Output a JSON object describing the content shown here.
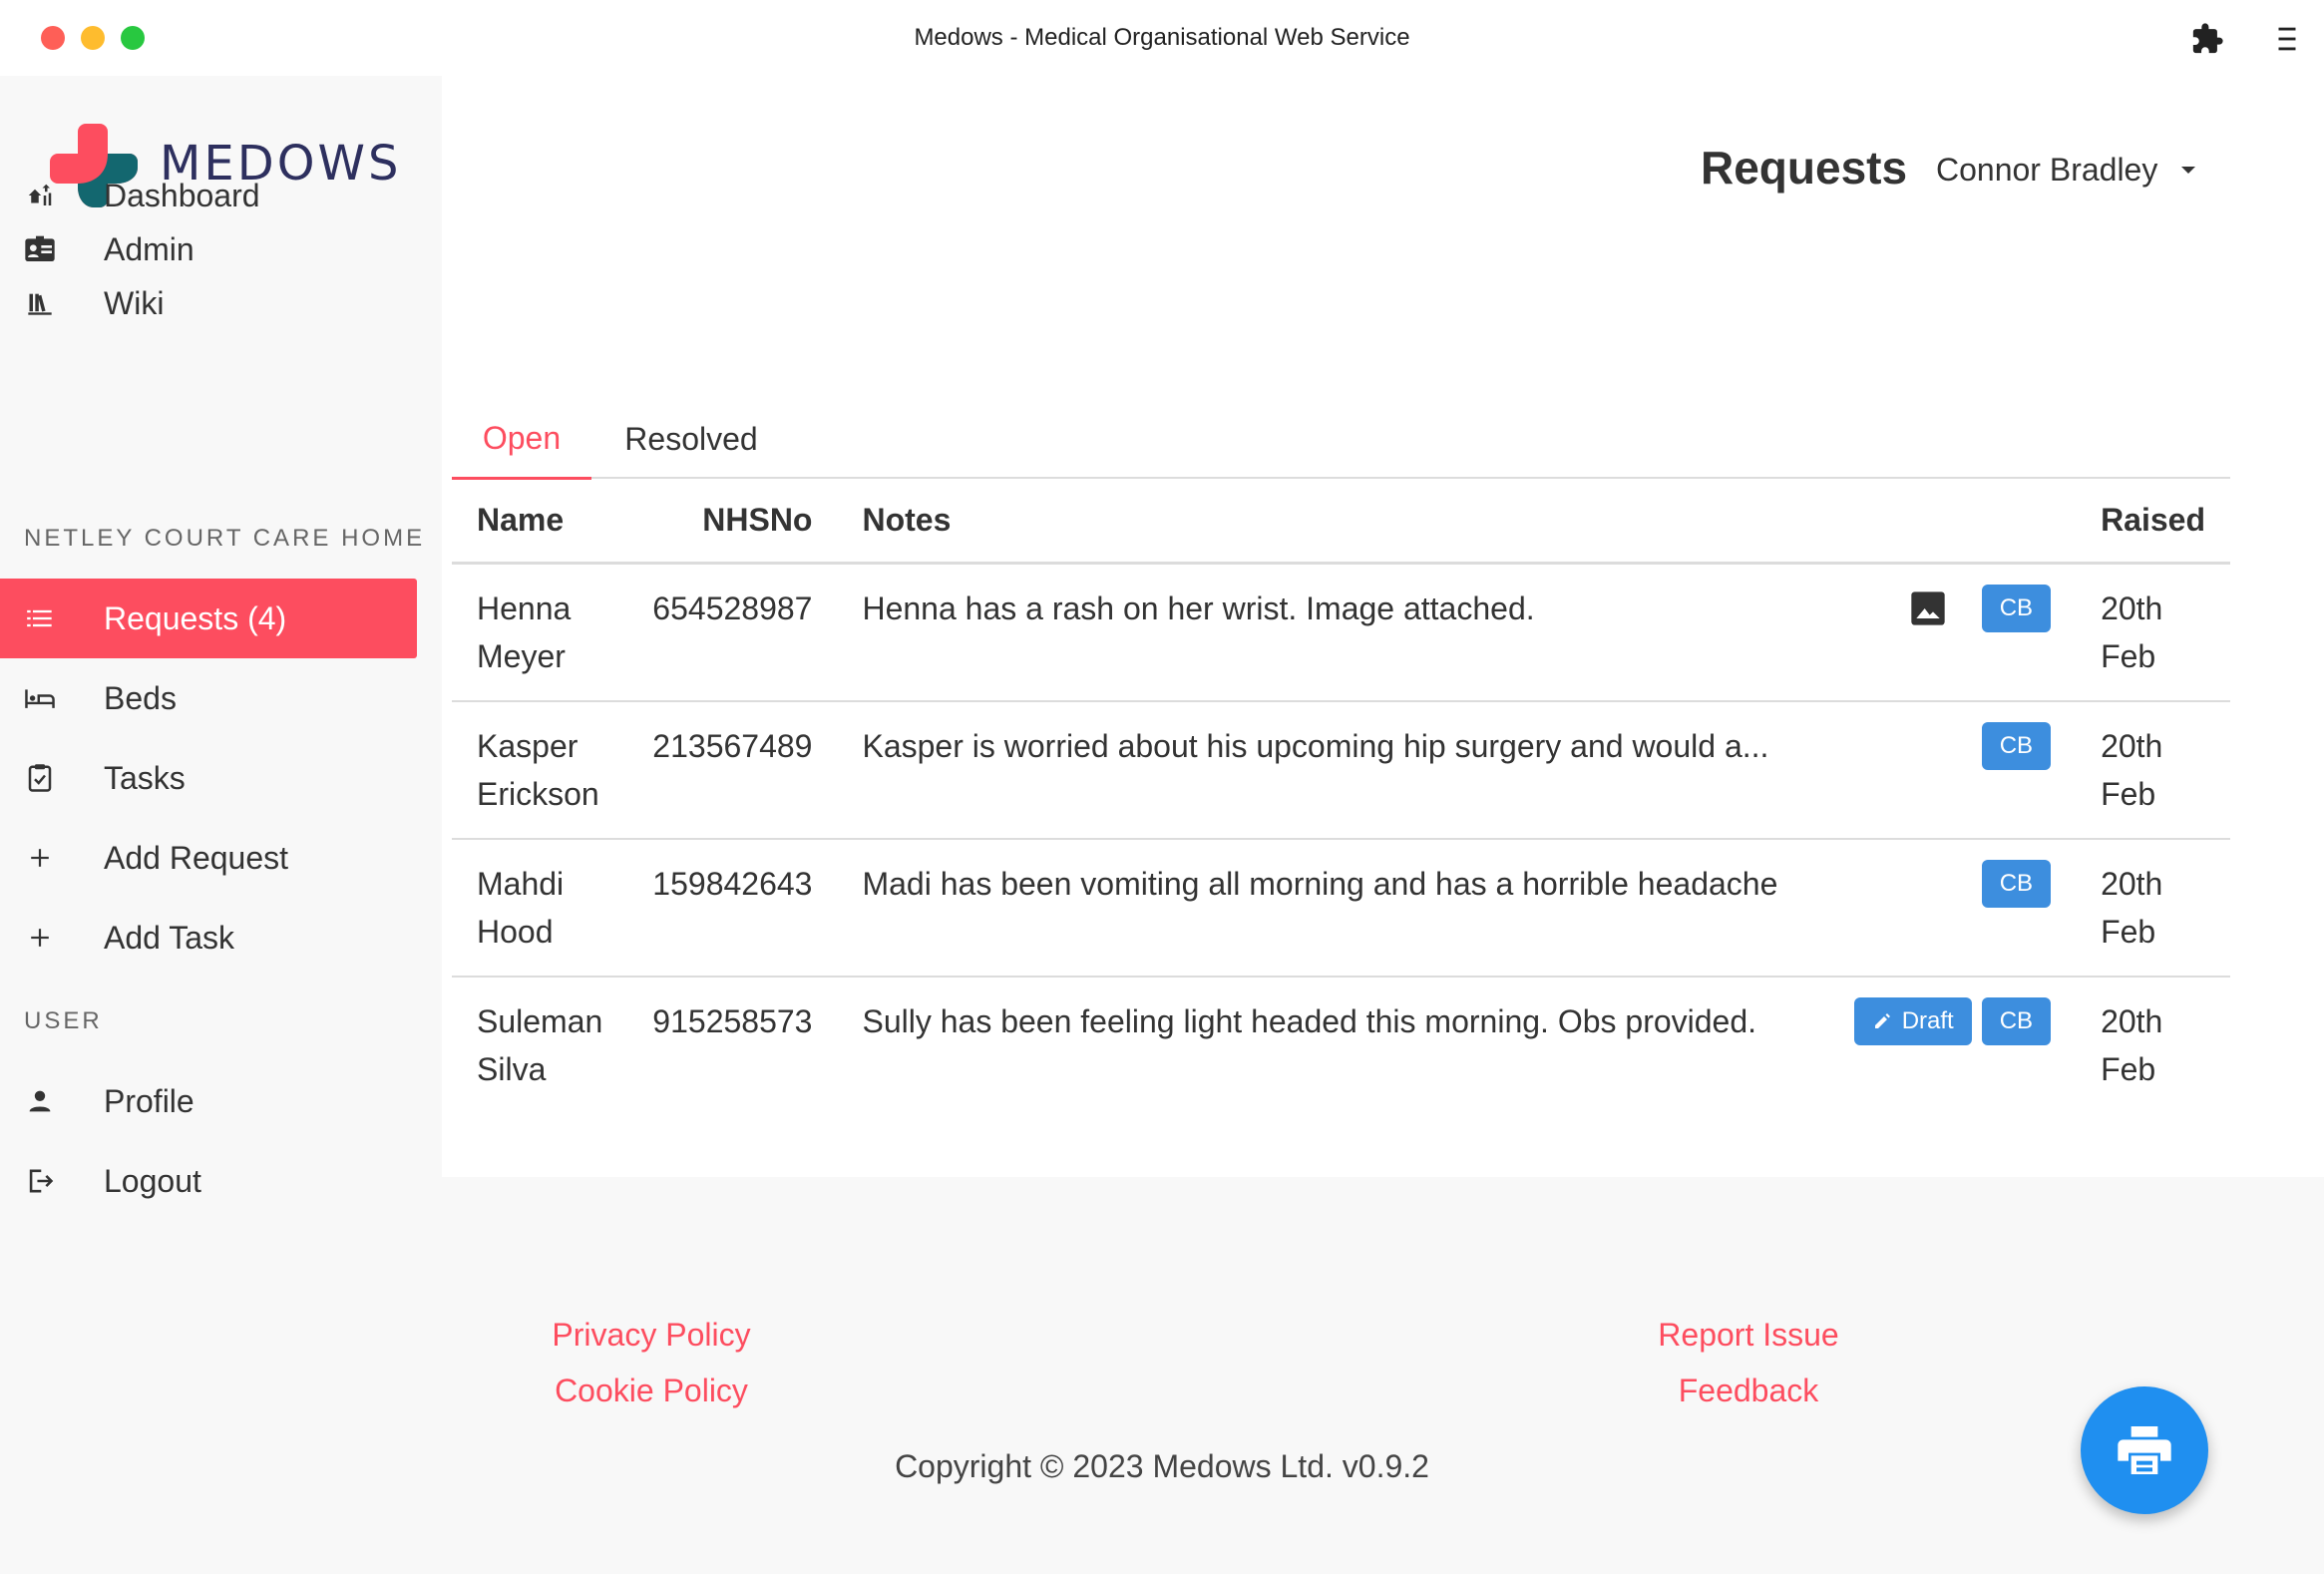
{
  "window": {
    "title": "Medows - Medical Organisational Web Service"
  },
  "brand": {
    "name": "MEDOWS",
    "accent": "#fd4d5f",
    "teal": "#13676f",
    "navy": "#2d2f5e"
  },
  "sidebar": {
    "main_items": [
      {
        "label": "Dashboard",
        "icon": "dashboard-icon"
      },
      {
        "label": "Admin",
        "icon": "admin-card-icon"
      },
      {
        "label": "Wiki",
        "icon": "books-icon"
      }
    ],
    "section_title": "NETLEY COURT CARE HOME",
    "section_items": [
      {
        "label": "Requests (4)",
        "icon": "list-icon",
        "active": true
      },
      {
        "label": "Beds",
        "icon": "bed-icon"
      },
      {
        "label": "Tasks",
        "icon": "clipboard-check-icon"
      },
      {
        "label": "Add Request",
        "icon": "plus-icon"
      },
      {
        "label": "Add Task",
        "icon": "plus-icon"
      }
    ],
    "user_section_title": "USER",
    "user_items": [
      {
        "label": "Profile",
        "icon": "person-icon"
      },
      {
        "label": "Logout",
        "icon": "logout-icon"
      }
    ]
  },
  "header": {
    "page_title": "Requests",
    "user_name": "Connor Bradley"
  },
  "tabs": [
    {
      "label": "Open",
      "active": true
    },
    {
      "label": "Resolved",
      "active": false
    }
  ],
  "table": {
    "columns": [
      "Name",
      "NHSNo",
      "Notes",
      "Raised"
    ],
    "rows": [
      {
        "first": "Henna",
        "last": "Meyer",
        "nhs": "654528987",
        "notes": "Henna has a rash on her wrist. Image attached.",
        "has_image": true,
        "draft": false,
        "initials": "CB",
        "raised_day": "20th",
        "raised_month": "Feb"
      },
      {
        "first": "Kasper",
        "last": "Erickson",
        "nhs": "213567489",
        "notes": "Kasper is worried about his upcoming hip surgery and would a...",
        "has_image": false,
        "draft": false,
        "initials": "CB",
        "raised_day": "20th",
        "raised_month": "Feb"
      },
      {
        "first": "Mahdi",
        "last": "Hood",
        "nhs": "159842643",
        "notes": "Madi has been vomiting all morning and has a horrible headache",
        "has_image": false,
        "draft": false,
        "initials": "CB",
        "raised_day": "20th",
        "raised_month": "Feb"
      },
      {
        "first": "Suleman",
        "last": "Silva",
        "nhs": "915258573",
        "notes": "Sully has been feeling light headed this morning. Obs provided.",
        "has_image": false,
        "draft": true,
        "draft_label": "Draft",
        "initials": "CB",
        "raised_day": "20th",
        "raised_month": "Feb"
      }
    ]
  },
  "footer": {
    "privacy": "Privacy Policy",
    "cookie": "Cookie Policy",
    "report": "Report Issue",
    "feedback": "Feedback",
    "copyright": "Copyright © 2023 Medows Ltd. v0.9.2"
  }
}
